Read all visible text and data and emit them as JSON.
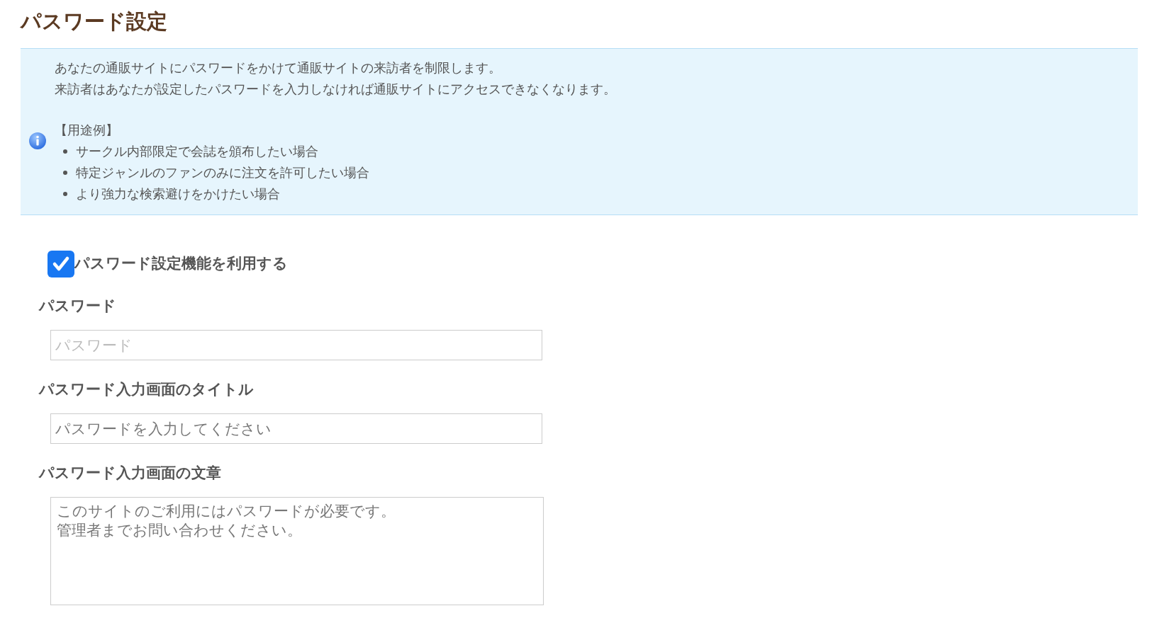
{
  "page_title": "パスワード設定",
  "info": {
    "lines": [
      "あなたの通販サイトにパスワードをかけて通販サイトの来訪者を制限します。",
      "来訪者はあなたが設定したパスワードを入力しなければ通販サイトにアクセスできなくなります。"
    ],
    "heading": "【用途例】",
    "examples": [
      "サークル内部限定で会誌を頒布したい場合",
      "特定ジャンルのファンのみに注文を許可したい場合",
      "より強力な検索避けをかけたい場合"
    ]
  },
  "enable": {
    "label": "パスワード設定機能を利用する",
    "checked": true
  },
  "fields": [
    {
      "kind": "input",
      "label": "パスワード",
      "placeholder": "パスワード"
    },
    {
      "kind": "input",
      "label": "パスワード入力画面のタイトル",
      "value": "パスワードを入力してください"
    },
    {
      "kind": "textarea",
      "label": "パスワード入力画面の文章",
      "lines": [
        "このサイトのご利用にはパスワードが必要です。",
        "管理者までお問い合わせください。"
      ]
    }
  ]
}
